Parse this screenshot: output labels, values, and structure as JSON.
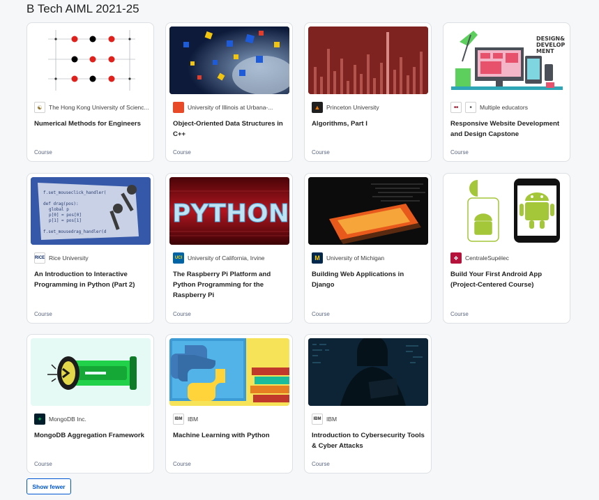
{
  "page": {
    "title": "B Tech AIML 2021-25"
  },
  "courses": [
    {
      "partner": "The Hong Kong University of Scienc...",
      "title": "Numerical Methods for Engineers",
      "type": "Course",
      "logo_text": "",
      "logo_color": "#8a6d1f"
    },
    {
      "partner": "University of Illinois at Urbana-...",
      "title": "Object-Oriented Data Structures in C++",
      "type": "Course",
      "logo_text": "",
      "logo_color": "#e84a27"
    },
    {
      "partner": "Princeton University",
      "title": "Algorithms, Part I",
      "type": "Course",
      "logo_text": "",
      "logo_color": "#e77500"
    },
    {
      "partner": "Multiple educators",
      "title": "Responsive Website Development and Design Capstone",
      "type": "Course",
      "logo_text": "",
      "logo_color": "#9b1b30"
    },
    {
      "partner": "Rice University",
      "title": "An Introduction to Interactive Programming in Python (Part 2)",
      "type": "Course",
      "logo_text": "RICE",
      "logo_color": "#00205b"
    },
    {
      "partner": "University of California, Irvine",
      "title": "The Raspberry Pi Platform and Python Programming for the Raspberry Pi",
      "type": "Course",
      "logo_text": "UCI",
      "logo_color": "#0064a4"
    },
    {
      "partner": "University of Michigan",
      "title": "Building Web Applications in Django",
      "type": "Course",
      "logo_text": "M",
      "logo_color": "#00274c"
    },
    {
      "partner": "CentraleSupélec",
      "title": "Build Your First Android App (Project-Centered Course)",
      "type": "Course",
      "logo_text": "",
      "logo_color": "#b5123b"
    },
    {
      "partner": "MongoDB Inc.",
      "title": "MongoDB Aggregation Framework",
      "type": "Course",
      "logo_text": "",
      "logo_color": "#13aa52"
    },
    {
      "partner": "IBM",
      "title": "Machine Learning with Python",
      "type": "Course",
      "logo_text": "IBM",
      "logo_color": "#1f1f1f"
    },
    {
      "partner": "IBM",
      "title": "Introduction to Cybersecurity Tools & Cyber Attacks",
      "type": "Course",
      "logo_text": "IBM",
      "logo_color": "#1f1f1f"
    }
  ],
  "thumb_text": {
    "python_banner": "PYTHON",
    "design_art": "DESIGN& DEVELOP MENT",
    "code_lines": [
      "f.set_mouseclick_handler(",
      "def drag(pos):",
      "global p",
      "p[0] = pos[0]",
      "p[1] = pos[1]",
      "f.set_mousedrag_handler(d"
    ]
  },
  "actions": {
    "show_fewer": "Show fewer"
  },
  "colors": {
    "accent": "#0056d2",
    "card_border": "#dcdfe3",
    "background": "#f5f7f8"
  }
}
